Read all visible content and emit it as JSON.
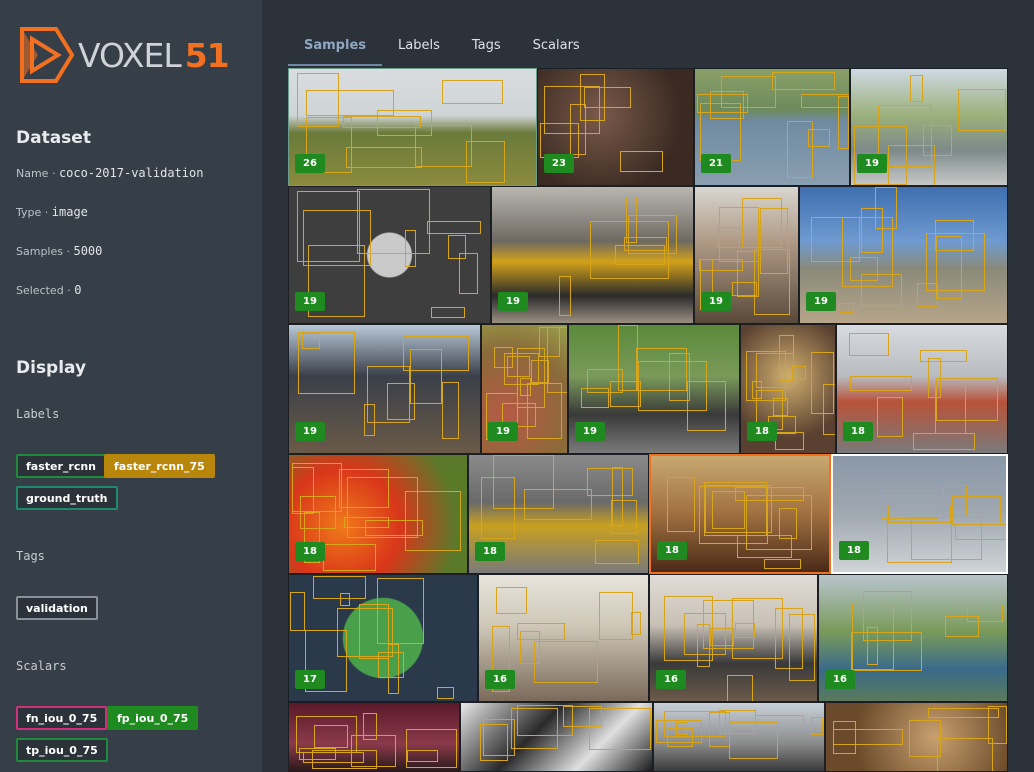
{
  "brand": {
    "word1": "VOXEL",
    "word2": "51",
    "accent": "#f37021"
  },
  "dataset": {
    "title": "Dataset",
    "fields": [
      {
        "key": "Name",
        "value": "coco-2017-validation"
      },
      {
        "key": "Type",
        "value": "image"
      },
      {
        "key": "Samples",
        "value": "5000"
      },
      {
        "key": "Selected",
        "value": "0"
      }
    ]
  },
  "display": {
    "title": "Display",
    "labels_title": "Labels",
    "labels": [
      {
        "label": "faster_rcnn",
        "color": "#1f8a3a",
        "style": "outlined"
      },
      {
        "label": "faster_rcnn_75",
        "color": "#b8860b",
        "style": "filled"
      },
      {
        "label": "ground_truth",
        "color": "#1f8a6a",
        "style": "outlined"
      }
    ],
    "tags_title": "Tags",
    "tags": [
      {
        "label": "validation",
        "color": "#8a9099",
        "style": "outlined"
      }
    ],
    "scalars_title": "Scalars",
    "scalars": [
      {
        "label": "fn_iou_0_75",
        "color": "#d0307a",
        "style": "outlined"
      },
      {
        "label": "fp_iou_0_75",
        "color": "#1f8a1f",
        "style": "filled"
      },
      {
        "label": "tp_iou_0_75",
        "color": "#1f8a3a",
        "style": "outlined"
      }
    ]
  },
  "tabs": [
    {
      "label": "Samples",
      "active": true
    },
    {
      "label": "Labels",
      "active": false
    },
    {
      "label": "Tags",
      "active": false
    },
    {
      "label": "Scalars",
      "active": false
    }
  ],
  "samples": [
    {
      "count": "26",
      "scene": "sheep-field"
    },
    {
      "count": "23",
      "scene": "dining-group"
    },
    {
      "count": "21",
      "scene": "river-boats"
    },
    {
      "count": "19",
      "scene": "city-street-cars"
    },
    {
      "count": "19",
      "scene": "donuts-tray"
    },
    {
      "count": "19",
      "scene": "train-platform"
    },
    {
      "count": "19",
      "scene": "restaurant-table"
    },
    {
      "count": "19",
      "scene": "beach-kites"
    },
    {
      "count": "19",
      "scene": "office-desk"
    },
    {
      "count": "19",
      "scene": "potatoes"
    },
    {
      "count": "19",
      "scene": "park-picnic"
    },
    {
      "count": "18",
      "scene": "kitchen-cook"
    },
    {
      "count": "18",
      "scene": "man-pointing"
    },
    {
      "count": "18",
      "scene": "oranges-market"
    },
    {
      "count": "18",
      "scene": "skateboard-street"
    },
    {
      "count": "18",
      "scene": "living-room"
    },
    {
      "count": "18",
      "scene": "skateboard-collage"
    },
    {
      "count": "17",
      "scene": "broccoli-plate"
    },
    {
      "count": "16",
      "scene": "kitchen-people"
    },
    {
      "count": "16",
      "scene": "couch-room"
    },
    {
      "count": "16",
      "scene": "tennis-court"
    },
    {
      "count": "",
      "scene": "hotel-lobby"
    },
    {
      "count": "",
      "scene": "umbrella-bw"
    },
    {
      "count": "",
      "scene": "crosswalk"
    },
    {
      "count": "",
      "scene": "teddy-bears"
    }
  ]
}
